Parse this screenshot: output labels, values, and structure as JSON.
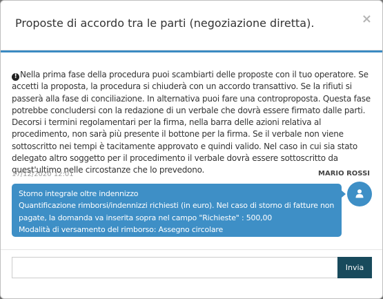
{
  "modal": {
    "title": "Proposte di accordo tra le parti (negoziazione diretta).",
    "close_label": "×"
  },
  "intro": {
    "icon": "exclamation-circle-icon",
    "icon_glyph": "!",
    "text": "Nella prima fase della procedura puoi scambiarti delle proposte con il tuo operatore. Se accetti la proposta, la procedura si chiuderà con un accordo transattivo. Se la rifiuti si passerà alla fase di conciliazione. In alternativa puoi fare una controproposta. Questa fase potrebbe concludersi con la redazione di un verbale che dovrà essere firmato dalle parti. Decorsi i termini regolamentari per la firma, nella barra delle azioni relativa al procedimento, non sarà più presente il bottone per la firma. Se il verbale non viene sottoscritto nei tempi è tacitamente approvato e quindi valido. Nel caso in cui sia stato delegato altro soggetto per il procedimento il verbale dovrà essere sottoscritto da quest'ultimo nelle circostanze che lo prevedono."
  },
  "message": {
    "date": "17/12/2020 12:01",
    "author": "MARIO ROSSI",
    "lines": [
      "Storno integrale oltre indennizzo",
      "Quantificazione rimborsi/indennizzi richiesti (in euro). Nel caso di storno di fatture non",
      "pagate, la domanda va inserita sopra nel campo \"Richieste\" : 500,00",
      "Modalità di versamento del rimborso: Assegno circolare"
    ],
    "avatar_icon": "user-icon"
  },
  "composer": {
    "input_value": "",
    "send_label": "Invia"
  },
  "colors": {
    "accent": "#3b8ac2",
    "bubble": "#3e8fc6",
    "send_button": "#184a5c"
  }
}
